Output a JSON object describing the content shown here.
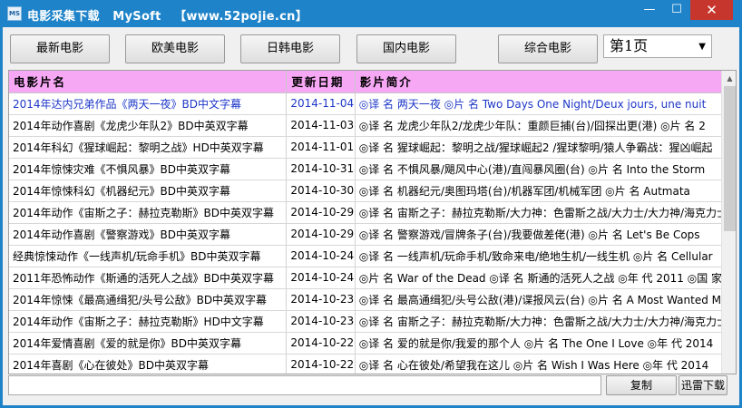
{
  "window": {
    "title": "电影采集下载   MySoft   【www.52pojie.cn】",
    "minimize_glyph": "—",
    "maximize_glyph": "☐",
    "close_glyph": "✕",
    "app_icon_text": "MS"
  },
  "nav": {
    "buttons": [
      "最新电影",
      "欧美电影",
      "日韩电影",
      "国内电影",
      "综合电影"
    ],
    "page_select": "第1页"
  },
  "table": {
    "columns": [
      "电影片名",
      "更新日期",
      "影片简介"
    ],
    "selected_row": 0,
    "rows": [
      {
        "name": "2014年达内兄弟作品《两天一夜》BD中文字幕",
        "date": "2014-11-04",
        "intro": "◎译 名 两天一夜 ◎片 名 Two Days One Night/Deux jours, une nuit"
      },
      {
        "name": "2014年动作喜剧《龙虎少年队2》BD中英双字幕",
        "date": "2014-11-03",
        "intro": "◎译 名 龙虎少年队2/龙虎少年队：重颜巨捕(台)/囧探出更(港) ◎片 名 2"
      },
      {
        "name": "2014年科幻《猩球崛起：黎明之战》HD中英双字幕",
        "date": "2014-11-01",
        "intro": "◎译 名 猩球崛起：黎明之战/猩球崛起2 /猩球黎明/猿人争霸战：猩凶崛起"
      },
      {
        "name": "2014年惊悚灾难《不惧风暴》BD中英双字幕",
        "date": "2014-10-31",
        "intro": "◎译 名 不惧风暴/飓风中心(港)/直闯暴风圈(台) ◎片 名 Into the Storm"
      },
      {
        "name": "2014年惊悚科幻《机器纪元》BD中英双字幕",
        "date": "2014-10-30",
        "intro": "◎译 名 机器纪元/奥图玛塔(台)/机器军团/机械军团 ◎片 名 Autmata"
      },
      {
        "name": "2014年动作《宙斯之子：赫拉克勒斯》BD中英双字幕",
        "date": "2014-10-29",
        "intro": "◎译 名 宙斯之子：赫拉克勒斯/大力神：色雷斯之战/大力士/大力神/海克力士"
      },
      {
        "name": "2014年动作喜剧《警察游戏》BD中英双字幕",
        "date": "2014-10-29",
        "intro": "◎译 名 警察游戏/冒牌条子(台)/我要做差佬(港) ◎片 名 Let's Be Cops"
      },
      {
        "name": "经典惊悚动作《一线声机/玩命手机》BD中英双字幕",
        "date": "2014-10-24",
        "intro": "◎译 名 一线声机/玩命手机/致命来电/绝地生机/一线生机 ◎片 名 Cellular"
      },
      {
        "name": "2011年恐怖动作《斯通的活死人之战》BD中英双字幕",
        "date": "2014-10-24",
        "intro": "◎片 名 War of the Dead ◎译 名 斯通的活死人之战 ◎年 代 2011 ◎国 家"
      },
      {
        "name": "2014年惊悚《最高通缉犯/头号公敌》BD中英双字幕",
        "date": "2014-10-23",
        "intro": "◎译 名 最高通缉犯/头号公敌(港)/谍报风云(台) ◎片 名 A Most Wanted Man"
      },
      {
        "name": "2014年动作《宙斯之子：赫拉克勒斯》HD中文字幕",
        "date": "2014-10-23",
        "intro": "◎译 名 宙斯之子：赫拉克勒斯/大力神：色雷斯之战/大力士/大力神/海克力士"
      },
      {
        "name": "2014年爱情喜剧《爱的就是你》BD中英双字幕",
        "date": "2014-10-22",
        "intro": "◎译 名 爱的就是你/我爱的那个人 ◎片 名 The One I Love ◎年 代 2014"
      },
      {
        "name": "2014年喜剧《心在彼处》BD中英双字幕",
        "date": "2014-10-22",
        "intro": "◎译 名 心在彼处/希望我在这儿 ◎片 名 Wish I Was Here ◎年 代 2014"
      }
    ]
  },
  "bottom": {
    "url_value": "",
    "copy_label": "复制",
    "xunlei_label": "迅雷下载"
  },
  "scrollbar": {
    "up_glyph": "▲",
    "position_fraction": 0.0
  }
}
